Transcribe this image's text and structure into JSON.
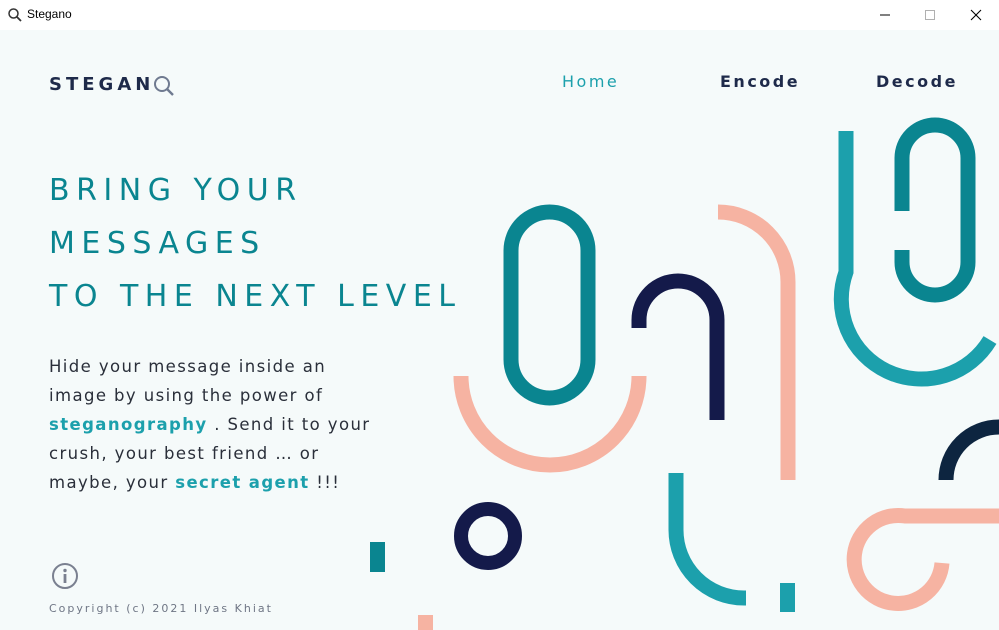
{
  "window": {
    "title": "Stegano",
    "icon": "search-icon",
    "controls": [
      "minimize-icon",
      "maximize-icon",
      "close-icon"
    ]
  },
  "brand": {
    "text": "STEGAN",
    "icon": "search-icon"
  },
  "nav": {
    "home": "Home",
    "encode": "Encode",
    "decode": "Decode",
    "active": "Home"
  },
  "hero": {
    "line1": "BRING YOUR",
    "line2": "MESSAGES",
    "line3": "TO THE NEXT LEVEL"
  },
  "description": {
    "part1": "Hide your message inside an image by using the power of",
    "highlight1": "steganography",
    "part2": ". Send it to your crush, your best friend … or maybe, your",
    "highlight2": "secret agent",
    "part3": "!!!"
  },
  "footer": {
    "info_icon": "info-icon",
    "copyright": "Copyright (c) 2021 Ilyas Khiat"
  },
  "colors": {
    "background": "#f5fafa",
    "teal_dark": "#0a8590",
    "teal": "#1ca0ac",
    "navy": "#141a4a",
    "salmon": "#f6b3a2",
    "text": "#1e2a4a"
  }
}
